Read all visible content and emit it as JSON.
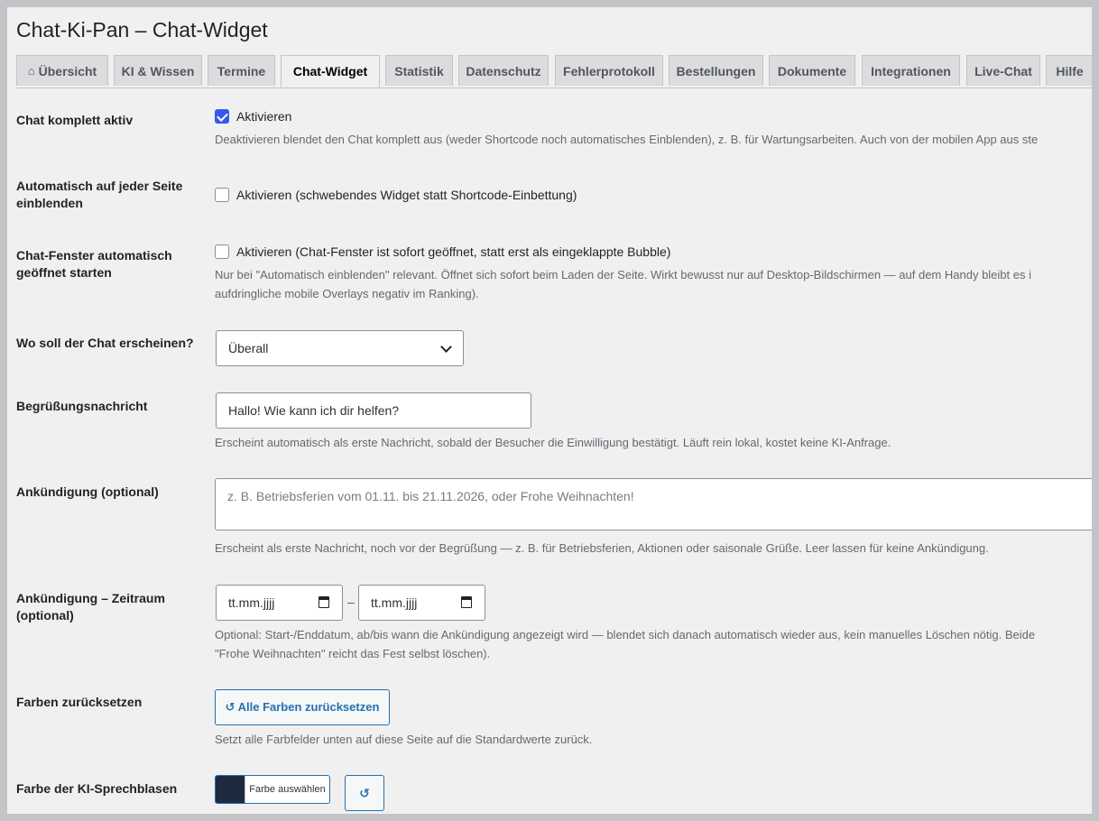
{
  "page_title": "Chat-Ki-Pan – Chat-Widget",
  "tabs": [
    {
      "label": "Übersicht",
      "icon": "house-icon"
    },
    {
      "label": "KI & Wissen"
    },
    {
      "label": "Termine"
    },
    {
      "label": "Chat-Widget",
      "active": true
    },
    {
      "label": "Statistik"
    },
    {
      "label": "Datenschutz"
    },
    {
      "label": "Fehlerprotokoll"
    },
    {
      "label": "Bestellungen"
    },
    {
      "label": "Dokumente"
    },
    {
      "label": "Integrationen"
    },
    {
      "label": "Live-Chat"
    },
    {
      "label": "Hilfe"
    }
  ],
  "fields": {
    "chat_active": {
      "label": "Chat komplett aktiv",
      "checkbox_label": "Aktivieren",
      "checked": true,
      "description": "Deaktivieren blendet den Chat komplett aus (weder Shortcode noch automatisches Einblenden), z. B. für Wartungsarbeiten. Auch von der mobilen App aus ste"
    },
    "auto_show": {
      "label": "Automatisch auf jeder Seite einblenden",
      "checkbox_label": "Aktivieren (schwebendes Widget statt Shortcode-Einbettung)",
      "checked": false
    },
    "auto_open": {
      "label": "Chat-Fenster automatisch geöffnet starten",
      "checkbox_label": "Aktivieren (Chat-Fenster ist sofort geöffnet, statt erst als eingeklappte Bubble)",
      "checked": false,
      "description_line1": "Nur bei \"Automatisch einblenden\" relevant. Öffnet sich sofort beim Laden der Seite. Wirkt bewusst nur auf Desktop-Bildschirmen — auf dem Handy bleibt es i",
      "description_line2": "aufdringliche mobile Overlays negativ im Ranking)."
    },
    "position": {
      "label": "Wo soll der Chat erscheinen?",
      "selected": "Überall"
    },
    "greeting": {
      "label": "Begrüßungsnachricht",
      "value": "Hallo! Wie kann ich dir helfen?",
      "description": "Erscheint automatisch als erste Nachricht, sobald der Besucher die Einwilligung bestätigt. Läuft rein lokal, kostet keine KI-Anfrage."
    },
    "announcement": {
      "label": "Ankündigung (optional)",
      "placeholder": "z. B. Betriebsferien vom 01.11. bis 21.11.2026, oder Frohe Weihnachten!",
      "description": "Erscheint als erste Nachricht, noch vor der Begrüßung — z. B. für Betriebsferien, Aktionen oder saisonale Grüße. Leer lassen für keine Ankündigung."
    },
    "announcement_period": {
      "label_line1": "Ankündigung – Zeitraum",
      "label_line2": "(optional)",
      "start_placeholder": "tt.mm.jjjj",
      "end_placeholder": "tt.mm.jjjj",
      "separator": "–",
      "description_line1": "Optional: Start-/Enddatum, ab/bis wann die Ankündigung angezeigt wird — blendet sich danach automatisch wieder aus, kein manuelles Löschen nötig. Beide",
      "description_line2": "\"Frohe Weihnachten\" reicht das Fest selbst löschen)."
    },
    "reset_colors": {
      "label": "Farben zurücksetzen",
      "button_label": "↺ Alle Farben zurücksetzen",
      "description": "Setzt alle Farbfelder unten auf diese Seite auf die Standardwerte zurück."
    },
    "bubble_color": {
      "label": "Farbe der KI-Sprechblasen",
      "picker_label": "Farbe auswählen",
      "color": "#1d2a3f",
      "reset_label": "↺"
    }
  },
  "colors": {
    "accent": "#3858e9",
    "link": "#2271b1"
  }
}
